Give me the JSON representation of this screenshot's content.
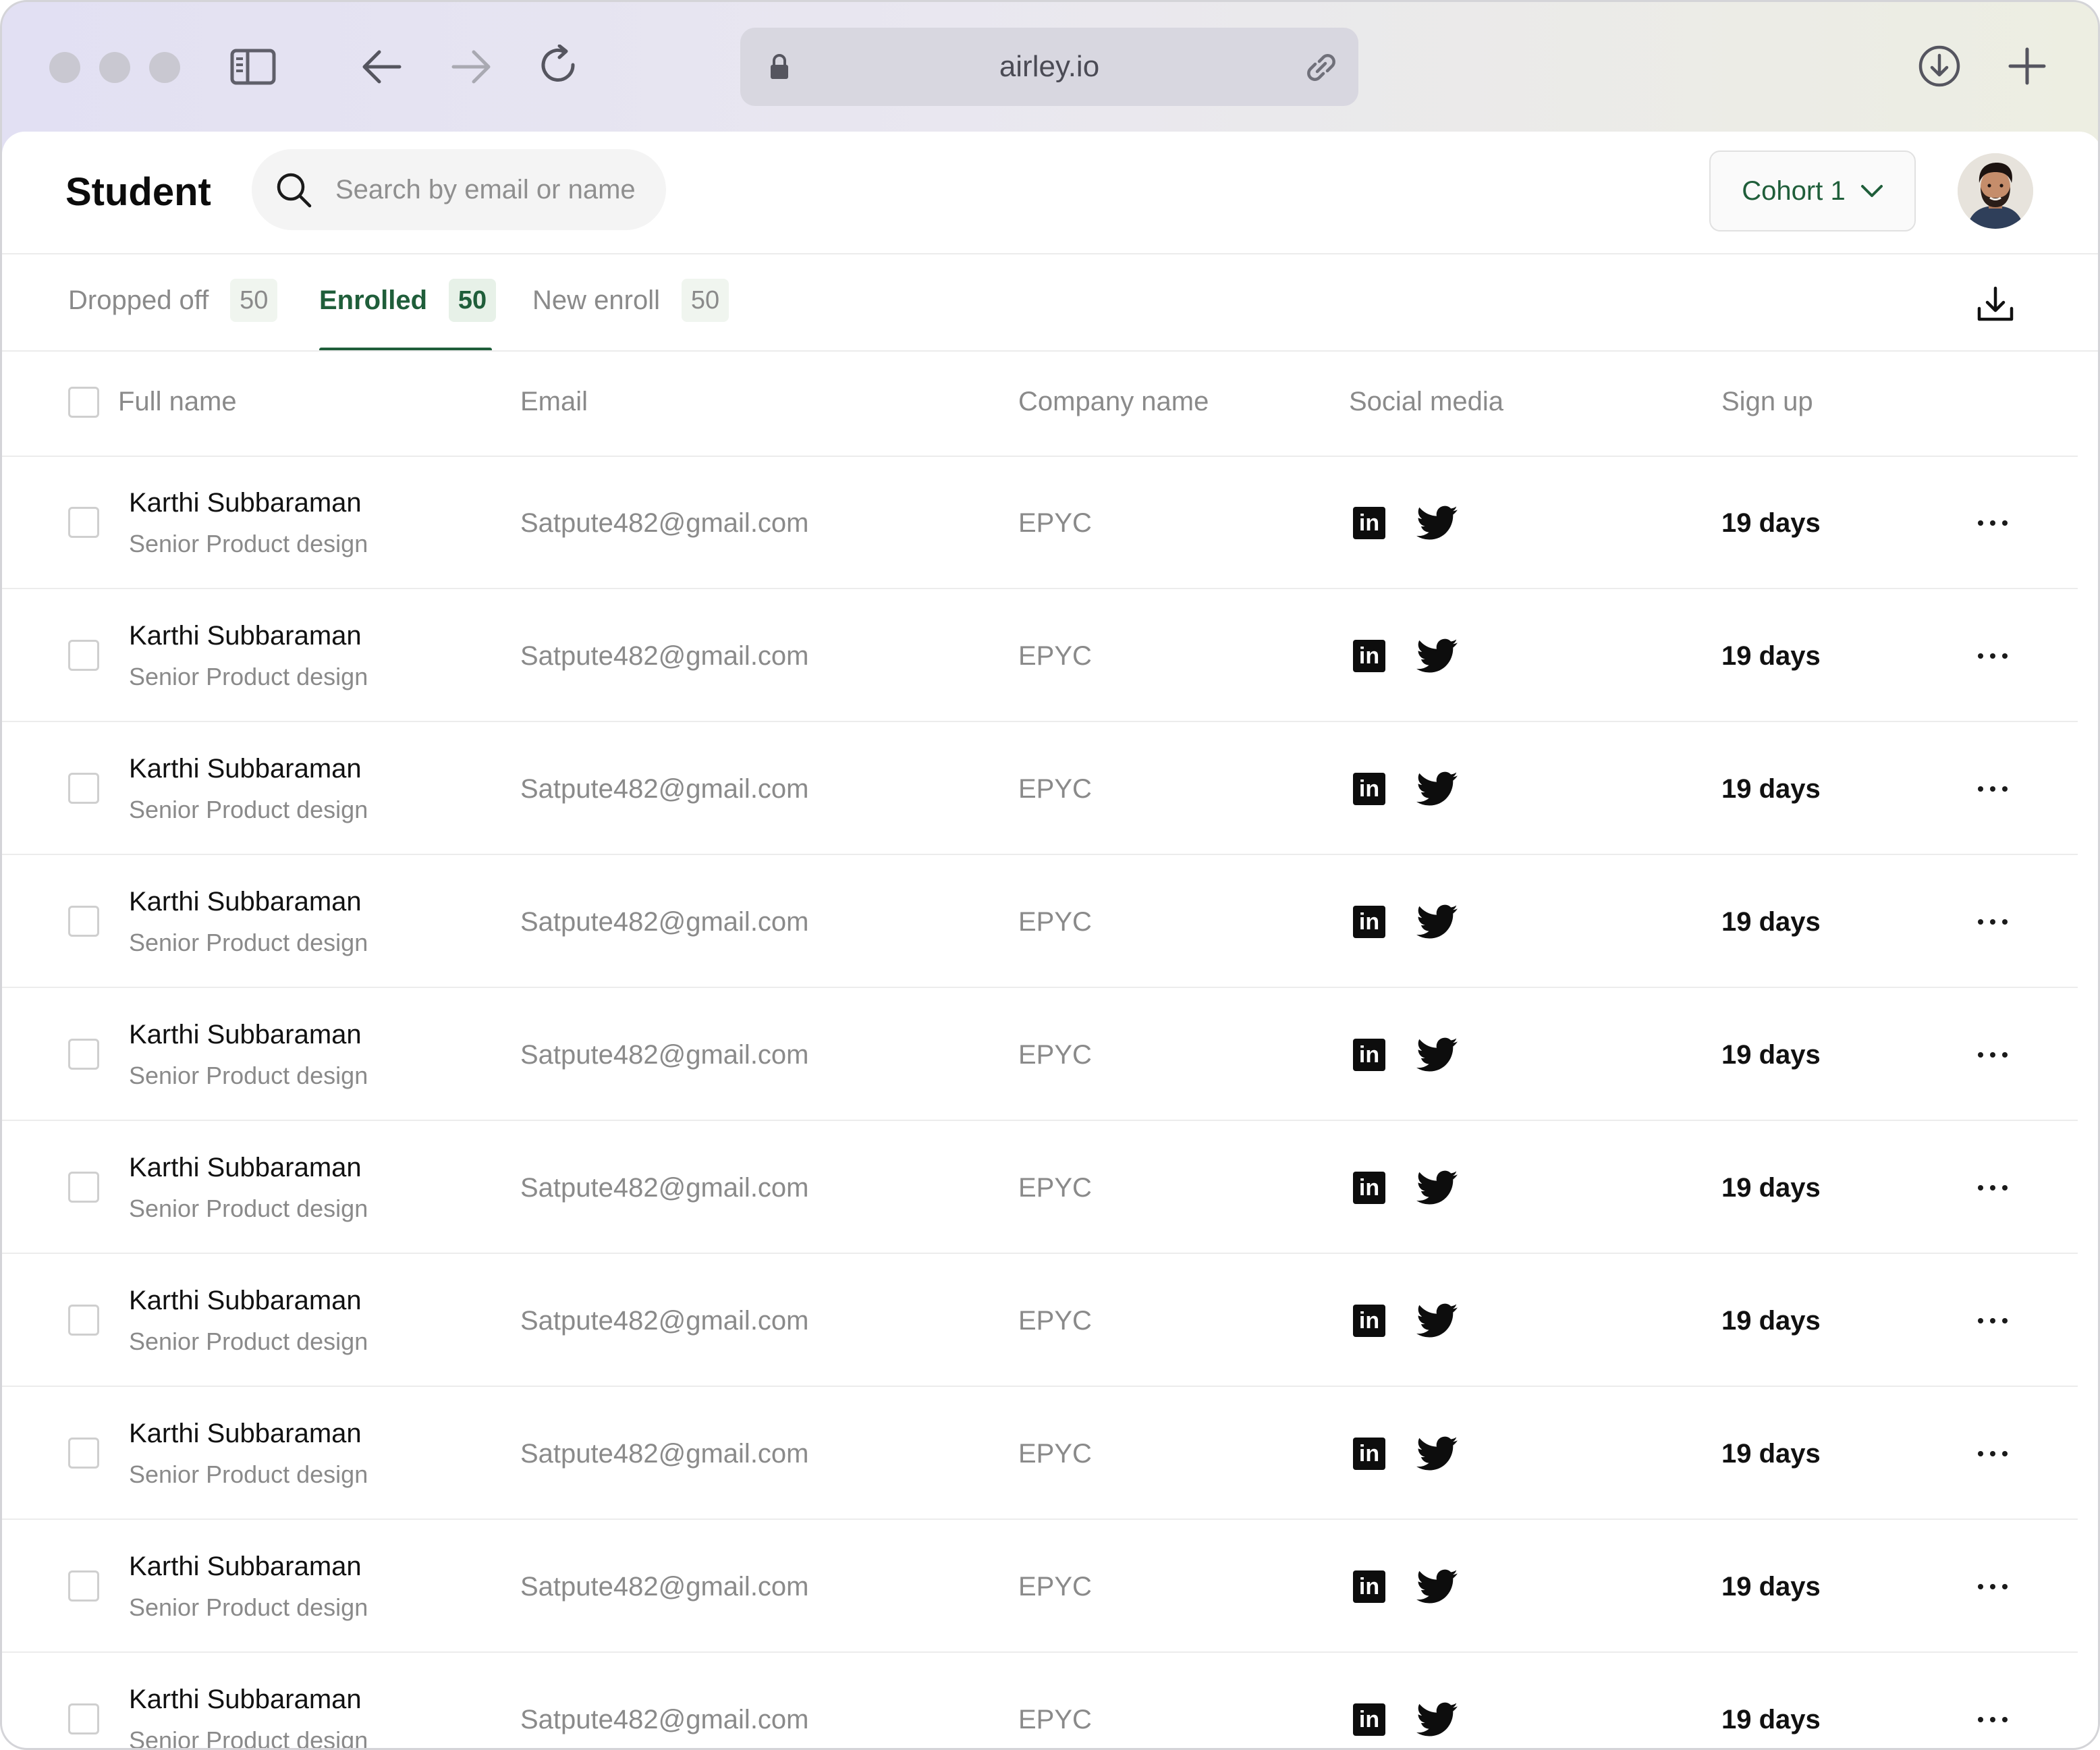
{
  "browser": {
    "address": "airley.io"
  },
  "header": {
    "title": "Student",
    "search_placeholder": "Search by email or name",
    "cohort_label": "Cohort 1"
  },
  "tabs": [
    {
      "label": "Dropped off",
      "count": "50",
      "active": false
    },
    {
      "label": "Enrolled",
      "count": "50",
      "active": true
    },
    {
      "label": "New enroll",
      "count": "50",
      "active": false
    }
  ],
  "table": {
    "columns": {
      "full_name": "Full name",
      "email": "Email",
      "company": "Company name",
      "social": "Social media",
      "signup": "Sign up"
    },
    "rows": [
      {
        "name": "Karthi Subbaraman",
        "role": "Senior Product design",
        "email": "Satpute482@gmail.com",
        "company": "EPYC",
        "signup": "19 days"
      },
      {
        "name": "Karthi Subbaraman",
        "role": "Senior Product design",
        "email": "Satpute482@gmail.com",
        "company": "EPYC",
        "signup": "19 days"
      },
      {
        "name": "Karthi Subbaraman",
        "role": "Senior Product design",
        "email": "Satpute482@gmail.com",
        "company": "EPYC",
        "signup": "19 days"
      },
      {
        "name": "Karthi Subbaraman",
        "role": "Senior Product design",
        "email": "Satpute482@gmail.com",
        "company": "EPYC",
        "signup": "19 days"
      },
      {
        "name": "Karthi Subbaraman",
        "role": "Senior Product design",
        "email": "Satpute482@gmail.com",
        "company": "EPYC",
        "signup": "19 days"
      },
      {
        "name": "Karthi Subbaraman",
        "role": "Senior Product design",
        "email": "Satpute482@gmail.com",
        "company": "EPYC",
        "signup": "19 days"
      },
      {
        "name": "Karthi Subbaraman",
        "role": "Senior Product design",
        "email": "Satpute482@gmail.com",
        "company": "EPYC",
        "signup": "19 days"
      },
      {
        "name": "Karthi Subbaraman",
        "role": "Senior Product design",
        "email": "Satpute482@gmail.com",
        "company": "EPYC",
        "signup": "19 days"
      },
      {
        "name": "Karthi Subbaraman",
        "role": "Senior Product design",
        "email": "Satpute482@gmail.com",
        "company": "EPYC",
        "signup": "19 days"
      },
      {
        "name": "Karthi Subbaraman",
        "role": "Senior Product design",
        "email": "Satpute482@gmail.com",
        "company": "EPYC",
        "signup": "19 days"
      }
    ]
  },
  "icons": {
    "linkedin_glyph": "in"
  },
  "colors": {
    "accent": "#1f5e3a",
    "muted_text": "#8a8a8a"
  }
}
